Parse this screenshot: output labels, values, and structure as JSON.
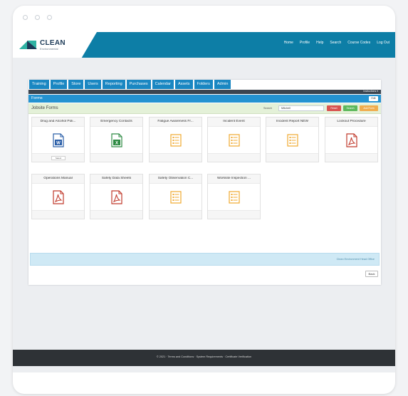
{
  "app": {
    "logo_text": "CLEAN",
    "logo_subtext": "Environmental"
  },
  "topnav": [
    "Home",
    "Profile",
    "Help",
    "Search",
    "Course Codes",
    "Log Out"
  ],
  "tabs": [
    "Training",
    "Profile",
    "Store",
    "Users",
    "Reporting",
    "Purchases",
    "Calendar",
    "Assets",
    "Folders",
    "Admin"
  ],
  "darkbar_label": "Instructions ▾",
  "section": {
    "title": "Forms",
    "edit_label": "Edit"
  },
  "subheader": {
    "title": "Jobsite Forms",
    "search_label": "Search",
    "search_value": "Mitchell",
    "buttons": {
      "reset": "Reset",
      "search": "Search",
      "add": "Add Form"
    }
  },
  "cards": [
    {
      "title": "Drug and Alcohol Poli...",
      "icon": "word-doc-icon",
      "color": "#2b5fa8",
      "badge": "W",
      "button": "Select"
    },
    {
      "title": "Emergency Contacts",
      "icon": "excel-doc-icon",
      "color": "#2e8b44",
      "badge": "X"
    },
    {
      "title": "Fatigue Awareness Fr...",
      "icon": "form-list-icon",
      "color": "#f0a930"
    },
    {
      "title": "Incident Event",
      "icon": "form-list-icon",
      "color": "#f0a930"
    },
    {
      "title": "Incident Report NEW",
      "icon": "form-list-icon",
      "color": "#f0a930"
    },
    {
      "title": "Lockout Procedure",
      "icon": "pdf-doc-icon",
      "color": "#c0392b"
    },
    {
      "title": "Operations Manual",
      "icon": "pdf-doc-icon",
      "color": "#c0392b"
    },
    {
      "title": "Safety Data Sheets",
      "icon": "pdf-doc-icon",
      "color": "#c0392b"
    },
    {
      "title": "Safety Observation C...",
      "icon": "form-list-icon",
      "color": "#f0a930"
    },
    {
      "title": "Worksite Inspection ...",
      "icon": "form-list-icon",
      "color": "#f0a930"
    }
  ],
  "info_bar_text": "Clean Environment Head Office",
  "back_label": "Back",
  "footer_text": "© 2021 · Terms and Conditions · System Requirements · Certificate Verification"
}
